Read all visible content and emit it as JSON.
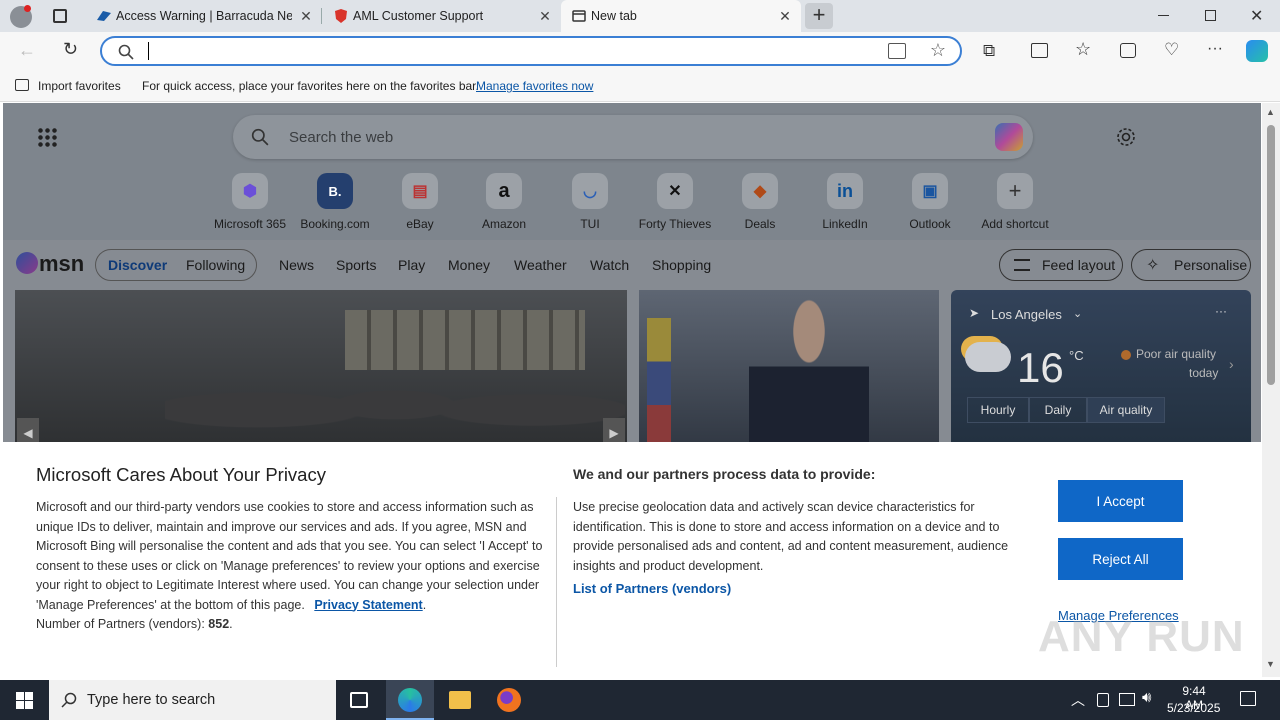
{
  "tabs": [
    {
      "title": "Access Warning | Barracuda Netw"
    },
    {
      "title": "AML Customer Support"
    },
    {
      "title": "New tab"
    }
  ],
  "address": {
    "value": ""
  },
  "favbar": {
    "import": "Import favorites",
    "hint": "For quick access, place your favorites here on the favorites bar.",
    "link": "Manage favorites now"
  },
  "ntp": {
    "search_placeholder": "Search the web",
    "shortcuts": [
      {
        "label": "Microsoft 365",
        "glyph": "⬢",
        "color": "#6b4fd8"
      },
      {
        "label": "Booking.com",
        "glyph": "B.",
        "color": "#1f3f7a"
      },
      {
        "label": "eBay",
        "glyph": "▤",
        "color": "#c33"
      },
      {
        "label": "Amazon",
        "glyph": "a",
        "color": "#111"
      },
      {
        "label": "TUI",
        "glyph": "◡",
        "color": "#2a6fd6"
      },
      {
        "label": "Forty Thieves",
        "glyph": "✕",
        "color": "#111"
      },
      {
        "label": "Deals",
        "glyph": "◆",
        "color": "#d4571e"
      },
      {
        "label": "LinkedIn",
        "glyph": "in",
        "color": "#0a66c2"
      },
      {
        "label": "Outlook",
        "glyph": "▣",
        "color": "#1a6fd1"
      },
      {
        "label": "Add shortcut",
        "glyph": "+",
        "color": "#333"
      }
    ]
  },
  "msn": {
    "logo": "msn",
    "nav": [
      "Discover",
      "Following",
      "News",
      "Sports",
      "Play",
      "Money",
      "Weather",
      "Watch",
      "Shopping"
    ],
    "feed_layout": "Feed layout",
    "personalise": "Personalise"
  },
  "weather": {
    "city": "Los Angeles",
    "temp": "16",
    "unit": "°C",
    "aq": "Poor air quality",
    "aq2": "today",
    "tabs": [
      "Hourly",
      "Daily",
      "Air quality"
    ]
  },
  "privacy": {
    "title": "Microsoft Cares About Your Privacy",
    "body": "Microsoft and our third-party vendors use cookies to store and access information such as unique IDs to deliver, maintain and improve our services and ads. If you agree, MSN and Microsoft Bing will personalise the content and ads that you see. You can select 'I Accept' to consent to these uses or click on 'Manage preferences' to review your options and exercise your right to object to Legitimate Interest where used.  You can change your selection under 'Manage Preferences' at the bottom of this page.",
    "privacy_link": "Privacy Statement",
    "partners_label": "Number of Partners (vendors):",
    "partners_count": "852",
    "right_title": "We and our partners process data to provide:",
    "right_body": "Use precise geolocation data and actively scan device characteristics for identification. This is done to store and access information on a device and to provide personalised ads and content, ad and content measurement, audience insights and product development.",
    "vendors_link": "List of Partners (vendors)",
    "accept": "I Accept",
    "reject": "Reject All",
    "manage": "Manage Preferences"
  },
  "taskbar": {
    "search_placeholder": "Type here to search",
    "time": "9:44 AM",
    "date": "5/23/2025"
  },
  "watermark": "ANY RUN"
}
